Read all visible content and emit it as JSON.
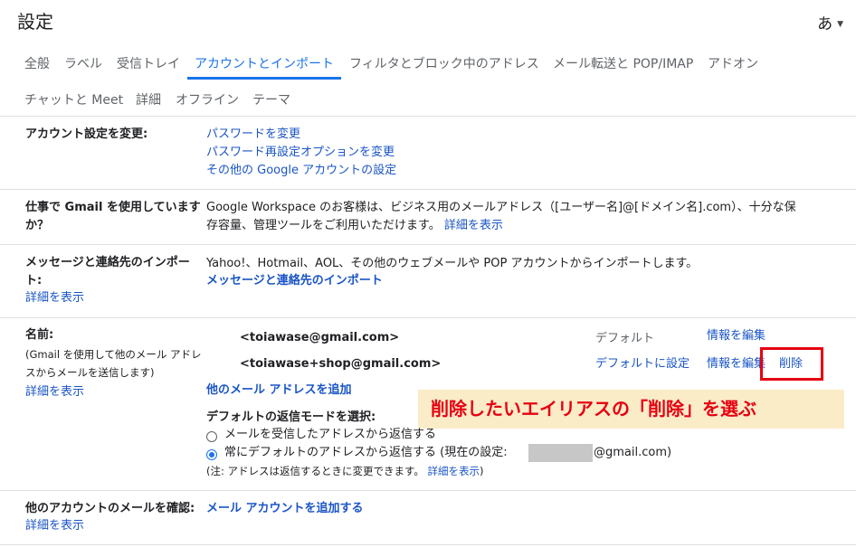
{
  "header": {
    "title": "設定",
    "input_lang": "あ"
  },
  "tabs": [
    {
      "label": "全般"
    },
    {
      "label": "ラベル"
    },
    {
      "label": "受信トレイ"
    },
    {
      "label": "アカウントとインポート"
    },
    {
      "label": "フィルタとブロック中のアドレス"
    },
    {
      "label": "メール転送と POP/IMAP"
    },
    {
      "label": "アドオン"
    },
    {
      "label": "チャットと Meet"
    },
    {
      "label": "詳細"
    },
    {
      "label": "オフライン"
    },
    {
      "label": "テーマ"
    }
  ],
  "sections": {
    "account": {
      "label": "アカウント設定を変更:",
      "links": [
        "パスワードを変更",
        "パスワード再設定オプションを変更",
        "その他の Google アカウントの設定"
      ]
    },
    "work": {
      "label_line1": "仕事で Gmail を使用しています",
      "label_line2": "か？",
      "desc_line1": "Google Workspace のお客様は、ビジネス用のメールアドレス（[ユーザー名]@[ドメイン名].com）、十分な保",
      "desc_line2": "存容量、管理ツールをご利用いただけます。",
      "learn_more": "詳細を表示"
    },
    "import": {
      "label_line1": "メッセージと連絡先のインポー",
      "label_line2": "ト:",
      "learn_more": "詳細を表示",
      "desc": "Yahoo!、Hotmail、AOL、その他のウェブメールや POP アカウントからインポートします。",
      "action": "メッセージと連絡先のインポート"
    },
    "name": {
      "label": "名前:",
      "sub_line1": "(Gmail を使用して他のメール アドレ",
      "sub_line2": "スからメールを送信します)",
      "learn_more": "詳細を表示",
      "addresses": [
        {
          "email": "<toiawase@gmail.com>",
          "status": "デフォルト",
          "edit": "情報を編集"
        },
        {
          "email": "<toiawase+shop@gmail.com>",
          "make_default": "デフォルトに設定",
          "edit": "情報を編集",
          "delete": "削除"
        }
      ],
      "add_address": "他のメール アドレスを追加",
      "reply_mode_title": "デフォルトの返信モードを選択:",
      "reply_option1": "メールを受信したアドレスから返信する",
      "reply_option2": "常にデフォルトのアドレスから返信する (現在の設定:",
      "reply_option2_suffix": "@gmail.com)",
      "note": "(注: アドレスは返信するときに変更できます。",
      "note_link": "詳細を表示",
      "note_end": ")"
    },
    "check_mail": {
      "label": "他のアカウントのメールを確認:",
      "learn_more": "詳細を表示",
      "action": "メール アカウントを追加する"
    }
  },
  "annotation": {
    "callout": "削除したいエイリアスの「削除」を選ぶ"
  },
  "colors": {
    "link": "#1a55c6",
    "accent": "#1a73e8",
    "highlight": "#e60012",
    "callout_bg": "#fbecc8"
  }
}
